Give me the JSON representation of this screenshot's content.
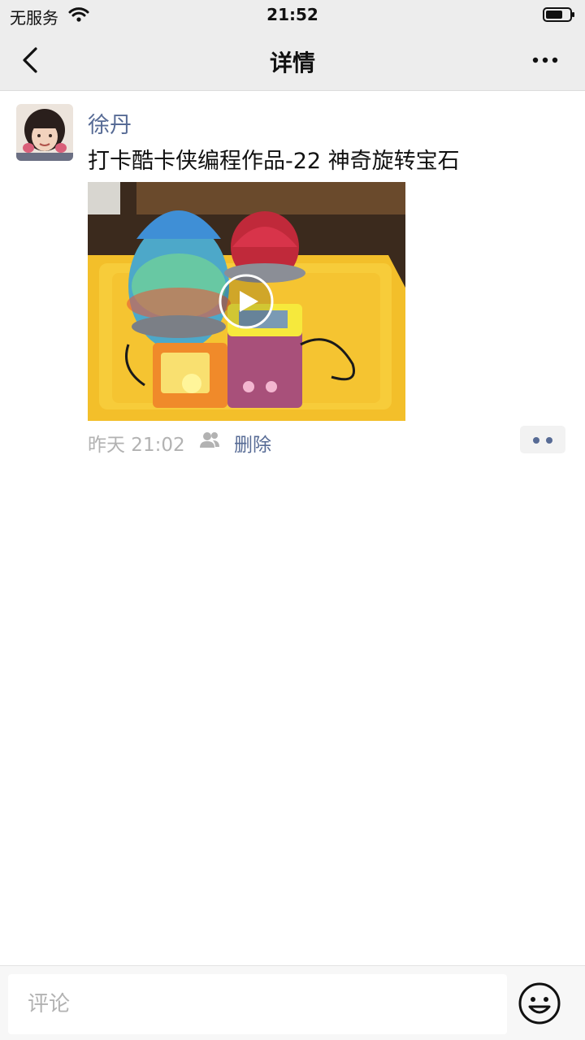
{
  "status_bar": {
    "carrier": "无服务",
    "time": "21:52"
  },
  "nav": {
    "title": "详情",
    "back_icon": "chevron-left-icon",
    "more_icon": "more-horizontal-icon"
  },
  "post": {
    "author": "徐丹",
    "text": "打卡酷卡侠编程作品-22 神奇旋转宝石",
    "media_type": "video",
    "time": "昨天 21:02",
    "delete_label": "删除",
    "visibility_icon": "people-icon"
  },
  "comment": {
    "placeholder": "评论",
    "emoji_icon": "smiley-icon"
  },
  "colors": {
    "link": "#576b95",
    "meta": "#b2b2b2",
    "bar_bg": "#ededed"
  }
}
